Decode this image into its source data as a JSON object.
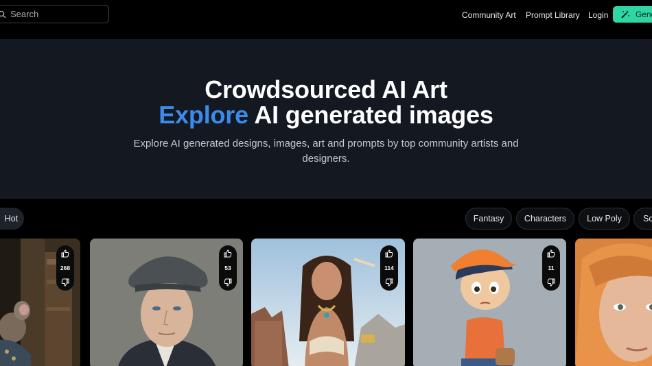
{
  "nav": {
    "search_placeholder": "Search",
    "links": [
      "Community Art",
      "Prompt Library",
      "Login"
    ],
    "generate_label": "Gene"
  },
  "hero": {
    "title_line1": "Crowdsourced AI Art",
    "title_accent": "Explore",
    "title_rest": " AI generated images",
    "subtitle": "Explore AI generated designs, images, art and prompts by top community artists and designers."
  },
  "filters": {
    "sort": "Hot",
    "categories": [
      "Fantasy",
      "Characters",
      "Low Poly",
      "Sc"
    ]
  },
  "gallery": [
    {
      "votes": "268"
    },
    {
      "votes": "53"
    },
    {
      "votes": "114"
    },
    {
      "votes": "11"
    },
    {
      "votes": ""
    }
  ],
  "colors": {
    "accent_blue": "#3b8bec",
    "generate_green": "#2fd6a4",
    "hero_bg": "#131821"
  }
}
